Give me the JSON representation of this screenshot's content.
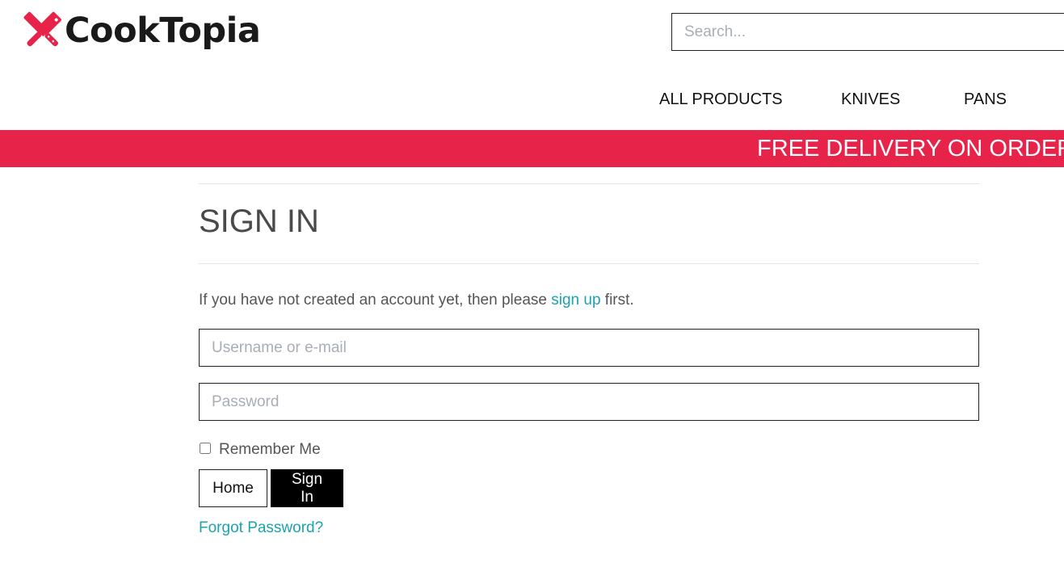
{
  "header": {
    "brand": "CookTopia",
    "logo_icon": "crossed-knives-icon",
    "search": {
      "placeholder": "Search...",
      "value": ""
    }
  },
  "nav": {
    "items": [
      {
        "label": "ALL PRODUCTS"
      },
      {
        "label": "KNIVES"
      },
      {
        "label": "PANS"
      }
    ]
  },
  "promo": {
    "text": "FREE DELIVERY ON ORDERS"
  },
  "main": {
    "title": "SIGN IN",
    "intro_before": "If you have not created an account yet, then please ",
    "intro_link": "sign up",
    "intro_after": " first.",
    "username": {
      "placeholder": "Username or e-mail",
      "value": ""
    },
    "password": {
      "placeholder": "Password",
      "value": ""
    },
    "remember_label": "Remember Me",
    "remember_checked": false,
    "home_button": "Home",
    "signin_button": "Sign In",
    "forgot_link": "Forgot Password?"
  },
  "colors": {
    "accent": "#e8234a",
    "link": "#1aa3b0",
    "text": "#555555",
    "button_dark": "#000000"
  }
}
